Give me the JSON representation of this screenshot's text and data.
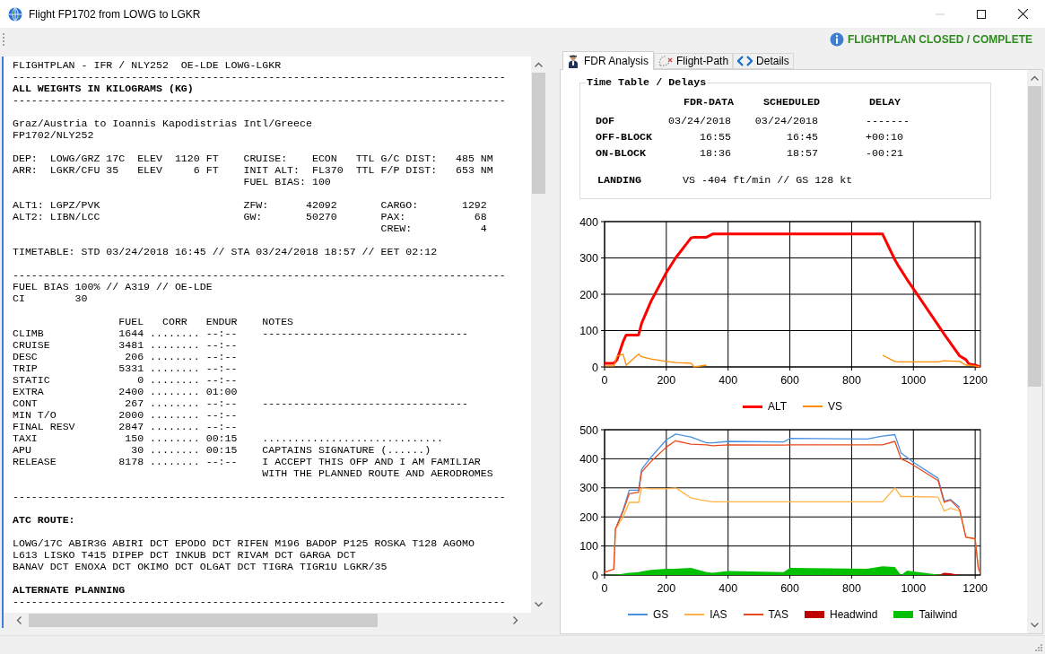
{
  "window": {
    "title": "Flight FP1702 from LOWG to LGKR",
    "controls": [
      {
        "kind": "minimize",
        "disabled": true
      },
      {
        "kind": "maximize",
        "disabled": false
      },
      {
        "kind": "close",
        "disabled": false
      }
    ]
  },
  "toolbar": {
    "status": "FLIGHTPLAN CLOSED / COMPLETE"
  },
  "document": {
    "sections": [
      {
        "lines": [
          {
            "kind": "text",
            "text": "FLIGHTPLAN - IFR / NLY252  OE-LDE LOWG-LGKR"
          },
          {
            "kind": "text",
            "text": "-------------------------------------------------------------------------------"
          },
          {
            "kind": "heading",
            "text": "ALL WEIGHTS IN KILOGRAMS (KG)"
          },
          {
            "kind": "text",
            "text": "-------------------------------------------------------------------------------"
          }
        ]
      },
      {
        "lines": [
          {
            "kind": "text",
            "text": "Graz/Austria to Ioannis Kapodistrias Intl/Greece"
          },
          {
            "kind": "text",
            "text": "FP1702/NLY252"
          }
        ]
      },
      {
        "lines": [
          {
            "kind": "text",
            "text": "DEP:  LOWG/GRZ 17C  ELEV  1120 FT    CRUISE:    ECON   TTL G/C DIST:   485 NM"
          },
          {
            "kind": "text",
            "text": "ARR:  LGKR/CFU 35   ELEV     6 FT    INIT ALT:  FL370  TTL F/P DIST:   653 NM"
          },
          {
            "kind": "text",
            "text": "                                     FUEL BIAS: 100"
          }
        ]
      },
      {
        "lines": [
          {
            "kind": "text",
            "text": "ALT1: LGPZ/PVK                       ZFW:      42092       CARGO:       1292"
          },
          {
            "kind": "text",
            "text": "ALT2: LIBN/LCC                       GW:       50270       PAX:           68"
          },
          {
            "kind": "text",
            "text": "                                                           CREW:           4"
          }
        ]
      },
      {
        "lines": [
          {
            "kind": "text",
            "text": "TIMETABLE: STD 03/24/2018 16:45 // STA 03/24/2018 18:57 // EET 02:12"
          }
        ]
      },
      {
        "lines": [
          {
            "kind": "text",
            "text": "-------------------------------------------------------------------------------"
          },
          {
            "kind": "text",
            "text": "FUEL BIAS 100% // A319 // OE-LDE"
          },
          {
            "kind": "text",
            "text": "CI        30"
          }
        ]
      },
      {
        "lines": [
          {
            "kind": "text",
            "text": "                 FUEL   CORR   ENDUR    NOTES"
          },
          {
            "kind": "text",
            "text": "CLIMB            1644 ........ --:--    ---------------------------------"
          },
          {
            "kind": "text",
            "text": "CRUISE           3481 ........ --:--"
          },
          {
            "kind": "text",
            "text": "DESC              206 ........ --:--"
          },
          {
            "kind": "text",
            "text": "TRIP             5331 ........ --:--"
          },
          {
            "kind": "text",
            "text": "STATIC              0 ........ --:--"
          },
          {
            "kind": "text",
            "text": "EXTRA            2400 ........ 01:00"
          },
          {
            "kind": "text",
            "text": "CONT              267 ........ --:--    ---------------------------------"
          },
          {
            "kind": "text",
            "text": "MIN T/O          2000 ........ --:--"
          },
          {
            "kind": "text",
            "text": "FINAL RESV       2847 ........ --:--"
          },
          {
            "kind": "text",
            "text": "TAXI              150 ........ 00:15    ............................."
          },
          {
            "kind": "text",
            "text": "APU                30 ........ 00:15    CAPTAINS SIGNATURE (......)"
          },
          {
            "kind": "text",
            "text": "RELEASE          8178 ........ --:--    I ACCEPT THIS OFP AND I AM FAMILIAR"
          },
          {
            "kind": "text",
            "text": "                                        WITH THE PLANNED ROUTE AND AERODROMES"
          }
        ]
      },
      {
        "lines": [
          {
            "kind": "text",
            "text": "-------------------------------------------------------------------------------"
          }
        ]
      },
      {
        "lines": [
          {
            "kind": "heading",
            "text": "ATC ROUTE:"
          }
        ]
      },
      {
        "lines": [
          {
            "kind": "text",
            "text": "LOWG/17C ABIR3G ABIRI DCT EPODO DCT RIFEN M196 BADOP P125 ROSKA T128 AGOMO"
          },
          {
            "kind": "text",
            "text": "L613 LISKO T415 DIPEP DCT INKUB DCT RIVAM DCT GARGA DCT"
          },
          {
            "kind": "text",
            "text": "BANAV DCT ENOXA DCT OKIMO DCT OLGAT DCT TIGRA TIGR1U LGKR/35"
          }
        ]
      },
      {
        "lines": [
          {
            "kind": "heading",
            "text": "ALTERNATE PLANNING"
          },
          {
            "kind": "text",
            "text": "-------------------------------------------------------------------------------"
          }
        ]
      }
    ]
  },
  "tabs": [
    {
      "label": "FDR Analysis",
      "kind": "pilot",
      "selected": true
    },
    {
      "label": "Flight-Path",
      "kind": "path",
      "selected": false
    },
    {
      "label": "Details",
      "kind": "code",
      "selected": false
    }
  ],
  "time_table": {
    "title": "Time Table / Delays",
    "columns": [
      "FDR-DATA",
      "SCHEDULED",
      "DELAY"
    ],
    "rows": [
      {
        "label": "DOF",
        "cells": [
          "03/24/2018",
          "03/24/2018",
          "-------"
        ]
      },
      {
        "label": "OFF-BLOCK",
        "cells": [
          "16:55",
          "16:45",
          "+00:10"
        ]
      },
      {
        "label": "ON-BLOCK",
        "cells": [
          "18:36",
          "18:57",
          "-00:21"
        ]
      }
    ],
    "landing": {
      "label": "LANDING",
      "value": "VS -404 ft/min // GS 128 kt"
    }
  },
  "charts": [
    {
      "chart_data": {
        "type": "line",
        "x": [
          0,
          30,
          40,
          60,
          70,
          110,
          120,
          150,
          200,
          230,
          280,
          290,
          330,
          350,
          400,
          580,
          600,
          850,
          900,
          940,
          950,
          980,
          1000,
          1080,
          1100,
          1150,
          1170,
          1180,
          1200,
          1215
        ],
        "grid": true,
        "legend": "bottom",
        "xlim": [
          0,
          1217
        ],
        "ylim": [
          0,
          400
        ],
        "xticks": [
          0,
          200,
          400,
          600,
          800,
          1000,
          1200
        ],
        "yticks": [
          0,
          100,
          200,
          300,
          400
        ],
        "series": [
          {
            "name": "ALT",
            "color": "#ff0000",
            "type": "line",
            "values": [
              10,
              10,
              20,
              70,
              88,
              88,
              120,
              180,
              260,
              300,
              355,
              357,
              357,
              366,
              366,
              366,
              366,
              366,
              366,
              295,
              280,
              240,
              215,
              115,
              90,
              30,
              20,
              8,
              5,
              0
            ]
          },
          {
            "name": "VS",
            "color": "#ff8c00",
            "type": "line",
            "values": [
              3,
              3,
              30,
              35,
              5,
              35,
              28,
              22,
              15,
              12,
              10,
              0,
              5,
              null,
              null,
              null,
              null,
              null,
              32,
              15,
              14,
              14,
              14,
              14,
              17,
              15,
              5,
              5,
              3,
              0
            ]
          }
        ]
      }
    },
    {
      "chart_data": {
        "type": "line",
        "x": [
          0,
          30,
          35,
          40,
          60,
          80,
          110,
          120,
          150,
          200,
          230,
          280,
          330,
          350,
          400,
          580,
          600,
          850,
          900,
          940,
          960,
          980,
          1000,
          1080,
          1100,
          1120,
          1150,
          1170,
          1200,
          1210,
          1215
        ],
        "grid": true,
        "legend": "bottom",
        "xlim": [
          0,
          1217
        ],
        "ylim": [
          0,
          500
        ],
        "xticks": [
          0,
          200,
          400,
          600,
          800,
          1000,
          1200
        ],
        "yticks": [
          0,
          100,
          200,
          300,
          400,
          500
        ],
        "series": [
          {
            "name": "GS",
            "color": "#4a90e2",
            "type": "line",
            "values": [
              null,
              null,
              null,
              172,
              224,
              292,
              292,
              364,
              405,
              465,
              485,
              475,
              455,
              455,
              460,
              458,
              470,
              468,
              478,
              483,
              420,
              404,
              388,
              333,
              255,
              260,
              233,
              null,
              null,
              null,
              null
            ]
          },
          {
            "name": "IAS",
            "color": "#ffb347",
            "type": "line",
            "values": [
              10,
              20,
              160,
              165,
              200,
              250,
              250,
              300,
              297,
              297,
              300,
              265,
              255,
              252,
              252,
              252,
              252,
              252,
              252,
              300,
              270,
              270,
              270,
              268,
              220,
              230,
              220,
              130,
              125,
              25,
              10
            ]
          },
          {
            "name": "TAS",
            "color": "#e8491d",
            "type": "line",
            "values": [
              10,
              20,
              160,
              170,
              220,
              280,
              285,
              355,
              390,
              440,
              462,
              450,
              448,
              445,
              448,
              447,
              448,
              448,
              448,
              460,
              400,
              390,
              378,
              325,
              250,
              258,
              225,
              130,
              125,
              25,
              10
            ]
          },
          {
            "name": "Headwind",
            "color": "#c00000",
            "type": "area",
            "values": [
              0,
              0,
              0,
              0,
              0,
              0,
              0,
              0,
              0,
              0,
              0,
              0,
              0,
              0,
              0,
              0,
              0,
              0,
              0,
              0,
              0,
              0,
              0,
              0,
              8,
              6,
              0,
              0,
              0,
              0,
              0
            ]
          },
          {
            "name": "Tailwind",
            "color": "#00c000",
            "type": "area",
            "values": [
              0,
              2,
              2,
              2,
              5,
              8,
              10,
              12,
              18,
              22,
              22,
              25,
              10,
              8,
              14,
              10,
              25,
              22,
              30,
              28,
              0,
              15,
              12,
              2,
              0,
              0,
              0,
              0,
              0,
              0,
              0
            ]
          }
        ]
      }
    }
  ]
}
